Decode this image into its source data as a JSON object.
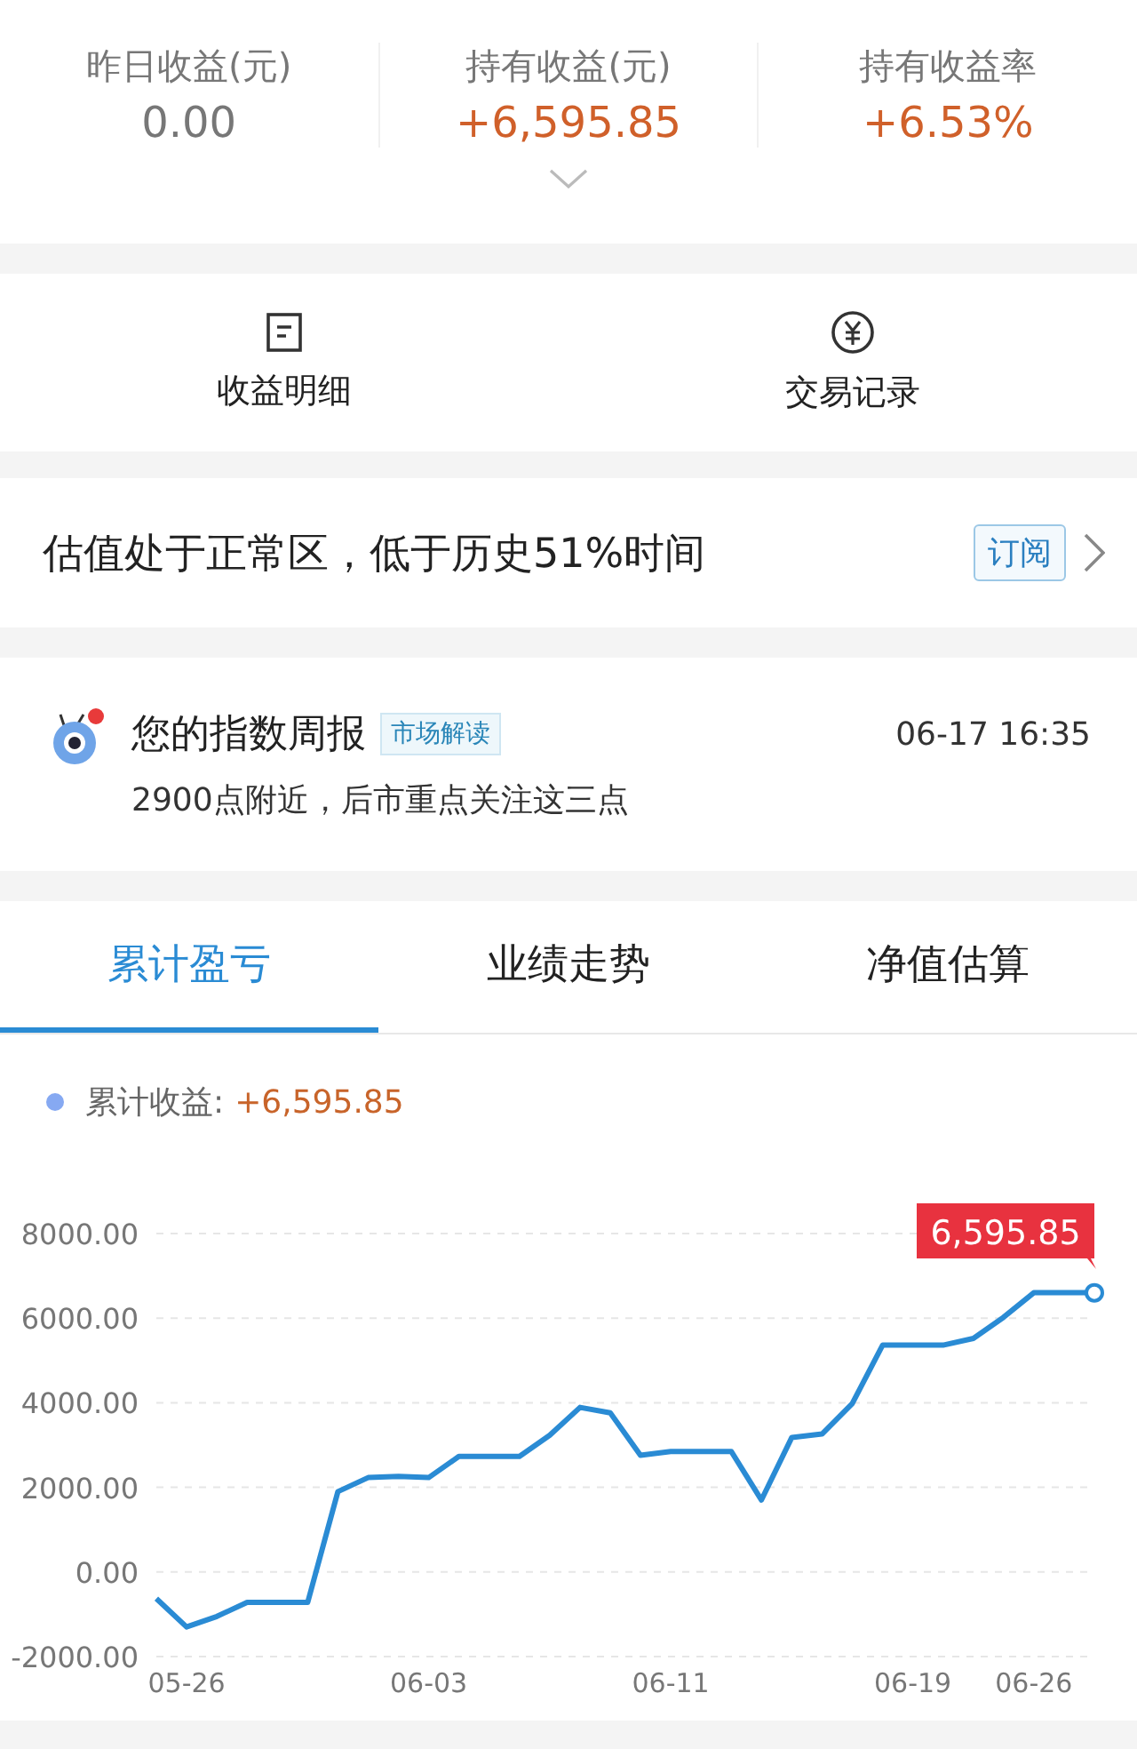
{
  "summary": {
    "stats": [
      {
        "label": "昨日收益(元)",
        "value": "0.00",
        "kind": "neutral"
      },
      {
        "label": "持有收益(元)",
        "value": "+6,595.85",
        "kind": "gain"
      },
      {
        "label": "持有收益率",
        "value": "+6.53%",
        "kind": "gain"
      }
    ]
  },
  "actions": [
    {
      "label": "收益明细"
    },
    {
      "label": "交易记录"
    }
  ],
  "valuation": {
    "text": "估值处于正常区，低于历史51%时间",
    "button": "订阅"
  },
  "report": {
    "title": "您的指数周报",
    "tag": "市场解读",
    "time": "06-17 16:35",
    "summary": "2900点附近，后市重点关注这三点",
    "unread": true
  },
  "tabs": [
    {
      "label": "累计盈亏",
      "selected": true
    },
    {
      "label": "业绩走势",
      "selected": false
    },
    {
      "label": "净值估算",
      "selected": false
    }
  ],
  "legend": {
    "label": "累计收益:",
    "value": "+6,595.85"
  },
  "tooltip": {
    "text": "6,595.85"
  },
  "chart_data": {
    "type": "line",
    "categories": [
      null,
      "05-26",
      null,
      null,
      null,
      null,
      null,
      null,
      null,
      "06-03",
      null,
      null,
      null,
      null,
      null,
      null,
      null,
      "06-11",
      null,
      null,
      null,
      null,
      null,
      null,
      null,
      "06-19",
      null,
      null,
      null,
      "06-26",
      null,
      null
    ],
    "series": [
      {
        "color": "#2a8bd4",
        "values": [
          -630,
          -1300,
          -1050,
          -720,
          -720,
          -720,
          1900,
          2230,
          2260,
          2230,
          2730,
          2730,
          2730,
          3230,
          3890,
          3760,
          2760,
          2850,
          2850,
          2850,
          1700,
          3180,
          3260,
          3980,
          5360,
          5360,
          5360,
          5520,
          6020,
          6600,
          6600,
          6600
        ]
      }
    ],
    "ylim": [
      -2000,
      8000
    ],
    "yticks": [
      {
        "value": -2000,
        "label": "-2000.00"
      },
      {
        "value": 0,
        "label": "0.00"
      },
      {
        "value": 2000,
        "label": "2000.00"
      },
      {
        "value": 4000,
        "label": "4000.00"
      },
      {
        "value": 6000,
        "label": "6000.00"
      },
      {
        "value": 8000,
        "label": "8000.00"
      }
    ],
    "grid": true
  }
}
